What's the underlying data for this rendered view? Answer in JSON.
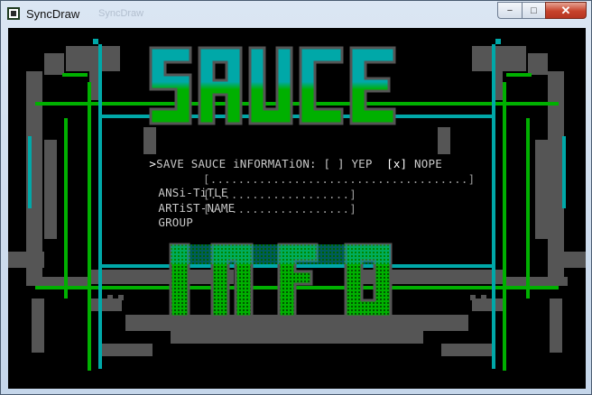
{
  "window": {
    "title": "SyncDraw",
    "ghost_title": "SyncDraw",
    "minimize_label": "−",
    "maximize_label": "□",
    "close_label": "✕"
  },
  "art": {
    "top_word": "SAUCE",
    "bottom_word": "INFO",
    "colors": {
      "green": "#00b000",
      "cyan": "#00a8a8",
      "gray": "#555555",
      "light_green": "#2ed52e"
    }
  },
  "sauce_prompt": {
    "cursor": ">",
    "label": "SAVE SAUCE iNFORMATiON:",
    "yes_box": "[ ]",
    "yes_label": "YEP",
    "no_box": "[x]",
    "no_label": "NOPE"
  },
  "fields": {
    "title_label": "ANSi-TiTLE",
    "title_value": "[.....................................]",
    "author_label": "ARTiST-NAME",
    "author_value": "[....................]",
    "group_label": "GROUP",
    "group_value": "[....................]"
  }
}
